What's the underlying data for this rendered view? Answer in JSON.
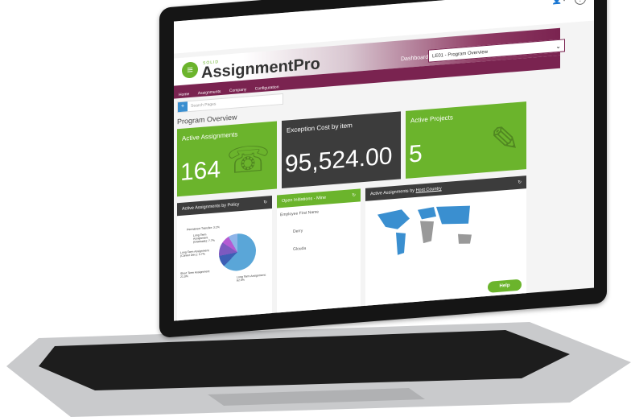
{
  "header": {
    "user_icon": "👤˅",
    "help_icon": "?"
  },
  "brand": {
    "small": "SOLID",
    "name": "AssignmentPro"
  },
  "dashboard": {
    "label": "Dashboard",
    "selected": "LE01 - Program Overview"
  },
  "nav": [
    "Home",
    "Assignments",
    "Company",
    "Configuration"
  ],
  "search": {
    "placeholder": "Search Pages"
  },
  "section_title": "Program Overview",
  "tiles": [
    {
      "label": "Active Assignments",
      "value": "164"
    },
    {
      "label": "Exception Cost by item",
      "value": "95,524.00"
    },
    {
      "label": "Active Projects",
      "value": "5"
    }
  ],
  "panels": {
    "policy": {
      "title": "Active Assignments by Policy",
      "labels": [
        "Permanent Transfer: 3.1%",
        "Long Term Assignment (Graduate): 7.7%",
        "Long Term Assignment (Career Dev.): 5.7%",
        "Short Term Assignment: 21.0%",
        "Long Term Assignment: 62.5%"
      ]
    },
    "initiations": {
      "title": "Open Initiations - Mine",
      "column": "Employee First Name",
      "rows": [
        "Derry",
        "Glouda"
      ]
    },
    "country": {
      "title_prefix": "Active Assignments by",
      "title_link": "Host Country"
    }
  },
  "help_button": "Help"
}
